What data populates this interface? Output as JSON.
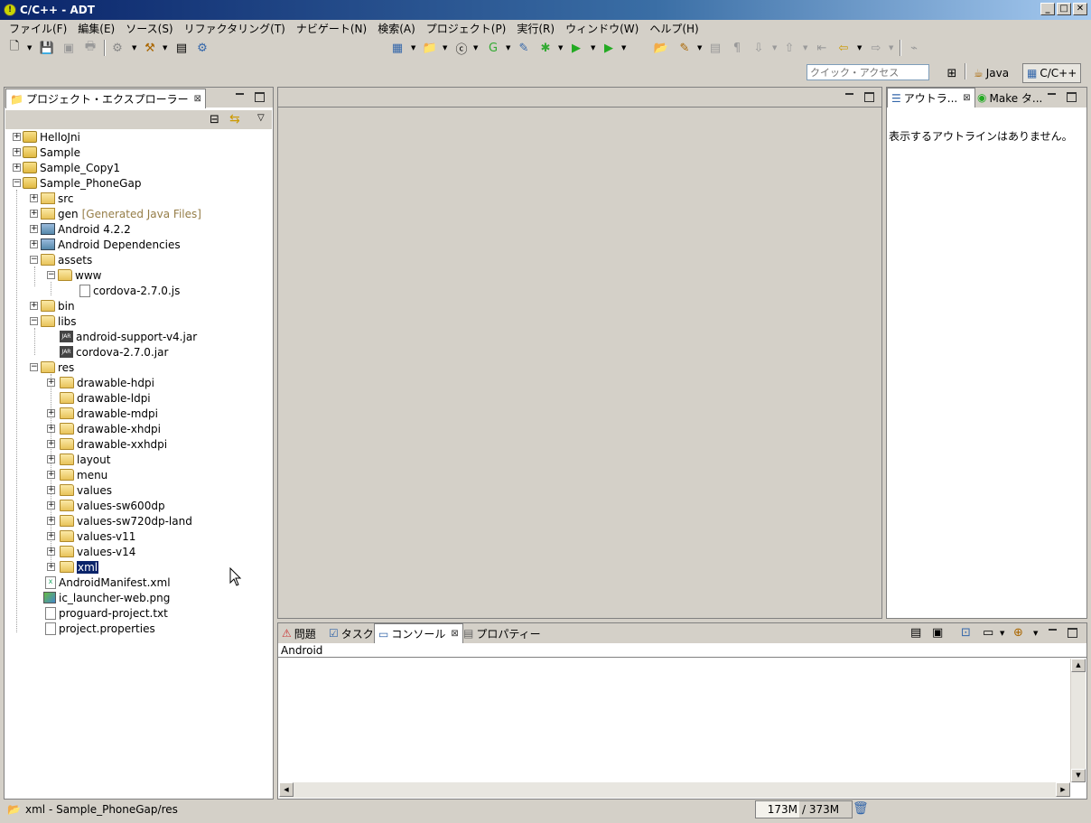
{
  "window": {
    "title": "C/C++ - ADT"
  },
  "menu": [
    "ファイル(F)",
    "編集(E)",
    "ソース(S)",
    "リファクタリング(T)",
    "ナビゲート(N)",
    "検索(A)",
    "プロジェクト(P)",
    "実行(R)",
    "ウィンドウ(W)",
    "ヘルプ(H)"
  ],
  "quick_access": {
    "placeholder": "クイック・アクセス"
  },
  "perspectives": {
    "java": "Java",
    "cpp": "C/C++"
  },
  "explorer": {
    "tab_label": "プロジェクト・エクスプローラー",
    "tree": [
      {
        "label": "HelloJni"
      },
      {
        "label": "Sample"
      },
      {
        "label": "Sample_Copy1"
      },
      {
        "label": "Sample_PhoneGap"
      },
      {
        "label": "src"
      },
      {
        "label": "gen",
        "decoration": "[Generated Java Files]"
      },
      {
        "label": "Android 4.2.2"
      },
      {
        "label": "Android Dependencies"
      },
      {
        "label": "assets"
      },
      {
        "label": "www"
      },
      {
        "label": "cordova-2.7.0.js"
      },
      {
        "label": "bin"
      },
      {
        "label": "libs"
      },
      {
        "label": "android-support-v4.jar"
      },
      {
        "label": "cordova-2.7.0.jar"
      },
      {
        "label": "res"
      },
      {
        "label": "drawable-hdpi"
      },
      {
        "label": "drawable-ldpi"
      },
      {
        "label": "drawable-mdpi"
      },
      {
        "label": "drawable-xhdpi"
      },
      {
        "label": "drawable-xxhdpi"
      },
      {
        "label": "layout"
      },
      {
        "label": "menu"
      },
      {
        "label": "values"
      },
      {
        "label": "values-sw600dp"
      },
      {
        "label": "values-sw720dp-land"
      },
      {
        "label": "values-v11"
      },
      {
        "label": "values-v14"
      },
      {
        "label": "xml"
      },
      {
        "label": "AndroidManifest.xml"
      },
      {
        "label": "ic_launcher-web.png"
      },
      {
        "label": "proguard-project.txt"
      },
      {
        "label": "project.properties"
      }
    ]
  },
  "outline": {
    "tab_outline": "アウトラ...",
    "tab_make": "Make タ...",
    "empty_message": "表示するアウトラインはありません。"
  },
  "bottom_panel": {
    "tabs": [
      "問題",
      "タスク",
      "コンソール",
      "プロパティー"
    ],
    "console_name": "Android"
  },
  "status": {
    "selection": "xml - Sample_PhoneGap/res",
    "mem_used": "173M",
    "mem_total": "/ 373M"
  }
}
